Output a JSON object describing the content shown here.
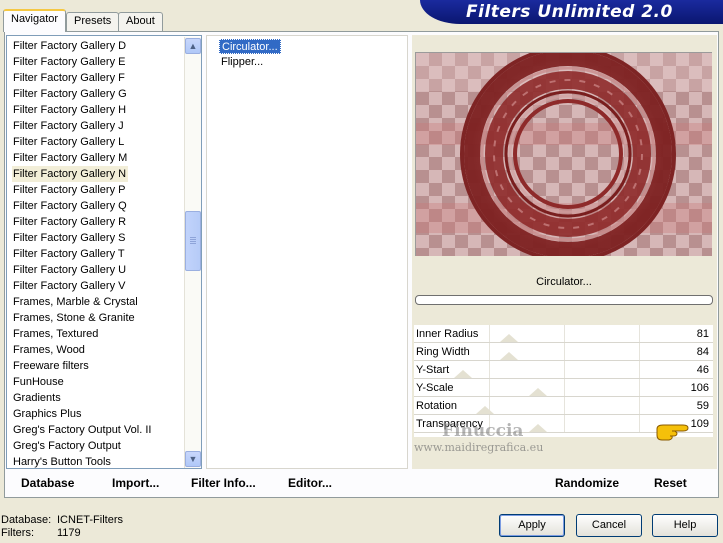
{
  "tabs": [
    {
      "label": "Navigator"
    },
    {
      "label": "Presets"
    },
    {
      "label": "About"
    }
  ],
  "brand": {
    "title": "Filters Unlimited 2.0"
  },
  "categories": [
    "Filter Factory Gallery D",
    "Filter Factory Gallery E",
    "Filter Factory Gallery F",
    "Filter Factory Gallery G",
    "Filter Factory Gallery H",
    "Filter Factory Gallery J",
    "Filter Factory Gallery L",
    "Filter Factory Gallery M",
    "Filter Factory Gallery N",
    "Filter Factory Gallery P",
    "Filter Factory Gallery Q",
    "Filter Factory Gallery R",
    "Filter Factory Gallery S",
    "Filter Factory Gallery T",
    "Filter Factory Gallery U",
    "Filter Factory Gallery V",
    "Frames, Marble & Crystal",
    "Frames, Stone & Granite",
    "Frames, Textured",
    "Frames, Wood",
    "Freeware filters",
    "FunHouse",
    "Gradients",
    "Graphics Plus",
    "Greg's Factory Output Vol. II",
    "Greg's Factory Output",
    "Harry's Button Tools"
  ],
  "selected_category": "Filter Factory Gallery N",
  "filters": [
    "Circulator...",
    "Flipper..."
  ],
  "selected_filter": "Circulator...",
  "preview": {
    "filter_name": "Circulator..."
  },
  "parameters": [
    {
      "label": "Inner Radius",
      "value": "81"
    },
    {
      "label": "Ring Width",
      "value": "84"
    },
    {
      "label": "Y-Start",
      "value": "46"
    },
    {
      "label": "Y-Scale",
      "value": "106"
    },
    {
      "label": "Rotation",
      "value": "59"
    },
    {
      "label": "Transparency",
      "value": "109"
    }
  ],
  "watermark": {
    "name": "Finuccia",
    "site": "www.maidiregrafica.eu"
  },
  "bottom_buttons": {
    "database": "Database",
    "import": "Import...",
    "filter_info": "Filter Info...",
    "editor": "Editor...",
    "randomize": "Randomize",
    "reset": "Reset"
  },
  "status": {
    "database_label": "Database:",
    "database_value": "ICNET-Filters",
    "filters_label": "Filters:",
    "filters_value": "1179"
  },
  "dialog_buttons": {
    "apply": "Apply",
    "cancel": "Cancel",
    "help": "Help"
  },
  "colors": {
    "selection": "#316ac5",
    "brand_banner": "#0a1670",
    "preview_ring": "#8e2a2a"
  },
  "icons": {
    "scroll_up": "chevron-up-icon",
    "scroll_down": "chevron-down-icon",
    "pointer": "pointing-hand-icon"
  }
}
